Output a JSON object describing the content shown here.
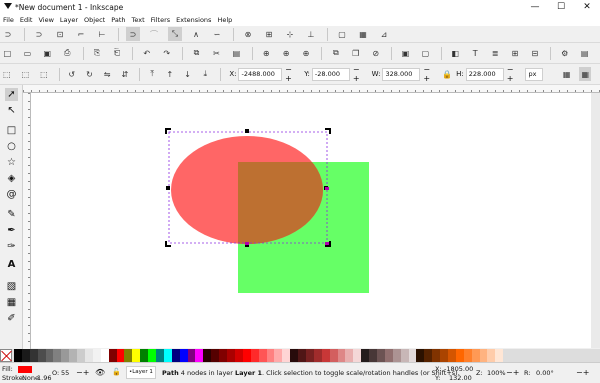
{
  "window": {
    "title": "*New document 1 - Inkscape",
    "minimize": "—",
    "maximize": "☐",
    "close": "✕"
  },
  "menu": [
    "File",
    "Edit",
    "View",
    "Layer",
    "Object",
    "Path",
    "Text",
    "Filters",
    "Extensions",
    "Help"
  ],
  "toolbar1_icons": [
    "new-document-icon",
    "open-icon",
    "save-icon",
    "print-icon",
    "import-icon",
    "export-icon",
    "undo-icon",
    "redo-icon",
    "copy-icon",
    "paste-icon",
    "zoom-selection-icon",
    "zoom-drawing-icon",
    "zoom-page-icon",
    "duplicate-icon",
    "clone-icon",
    "unlink-clone-icon",
    "group-icon",
    "ungroup-icon",
    "fill-stroke-icon",
    "text-font-icon",
    "layers-icon",
    "xml-editor-icon",
    "align-icon",
    "preferences-icon",
    "document-properties-icon"
  ],
  "toolbar2_icons": [
    "select-all-icon",
    "select-all-layers-icon",
    "deselect-icon",
    "rotate-ccw-icon",
    "rotate-cw-icon",
    "flip-horizontal-icon",
    "flip-vertical-icon",
    "raise-to-top-icon",
    "raise-icon",
    "lower-icon",
    "lower-to-bottom-icon"
  ],
  "toolcontrols": {
    "x_label": "X:",
    "x_value": "-2488.000",
    "y_label": "Y:",
    "y_value": "-28.000",
    "w_label": "W:",
    "w_value": "328.000",
    "h_label": "H:",
    "h_value": "228.000",
    "unit": "px"
  },
  "tools": [
    "selector-tool-icon",
    "node-tool-icon",
    "rectangle-tool-icon",
    "ellipse-tool-icon",
    "star-tool-icon",
    "3d-box-tool-icon",
    "spiral-tool-icon",
    "pencil-tool-icon",
    "pen-tool-icon",
    "calligraphy-tool-icon",
    "text-tool-icon",
    "gradient-tool-icon",
    "mesh-tool-icon",
    "dropper-tool-icon"
  ],
  "canvas": {
    "ellipse_color": "#ff6666",
    "rect_color": "#66ff66",
    "overlap_color": "#bd7031"
  },
  "palette": [
    "#000000",
    "#1a1a1a",
    "#333333",
    "#4d4d4d",
    "#666666",
    "#808080",
    "#999999",
    "#b3b3b3",
    "#cccccc",
    "#e6e6e6",
    "#f2f2f2",
    "#ffffff",
    "#800000",
    "#ff0000",
    "#808000",
    "#ffff00",
    "#008000",
    "#00ff00",
    "#008080",
    "#00ffff",
    "#000080",
    "#0000ff",
    "#800080",
    "#ff00ff",
    "#2b0000",
    "#550000",
    "#800000",
    "#aa0000",
    "#d40000",
    "#ff0000",
    "#ff2a2a",
    "#ff5555",
    "#ff8080",
    "#ffaaaa",
    "#ffd5d5",
    "#280b0b",
    "#501616",
    "#782121",
    "#a02c2c",
    "#c83737",
    "#d35f5f",
    "#de8787",
    "#e9afaf",
    "#f4d7d7",
    "#241c1c",
    "#483737",
    "#6c5353",
    "#916f6f",
    "#ac9393",
    "#c8b7b7",
    "#e3dbdb",
    "#2b1100",
    "#552200",
    "#803300",
    "#aa4400",
    "#d45500",
    "#ff6600",
    "#ff7f2a",
    "#ff9955",
    "#ffb380",
    "#ffccaa",
    "#ffe6d5"
  ],
  "status": {
    "fill_label": "Fill:",
    "fill_color": "#ff0000",
    "stroke_label": "Stroke:",
    "stroke_value": "None",
    "stroke_width": "1.96",
    "opacity_label": "O:",
    "opacity_value": "55",
    "layer_select": "•Layer 1",
    "message_bold": "Path",
    "message_rest": " 4 nodes in layer ",
    "message_layer": "Layer 1",
    "message_tail": ". Click selection to toggle scale/rotation handles (or Shift+s).",
    "cursor_x_label": "X:",
    "cursor_x": "-1805.00",
    "cursor_y_label": "Y:",
    "cursor_y": "132.00",
    "zoom_label": "Z:",
    "zoom": "100%",
    "rotation_label": "R:",
    "rotation": "0.00°"
  }
}
